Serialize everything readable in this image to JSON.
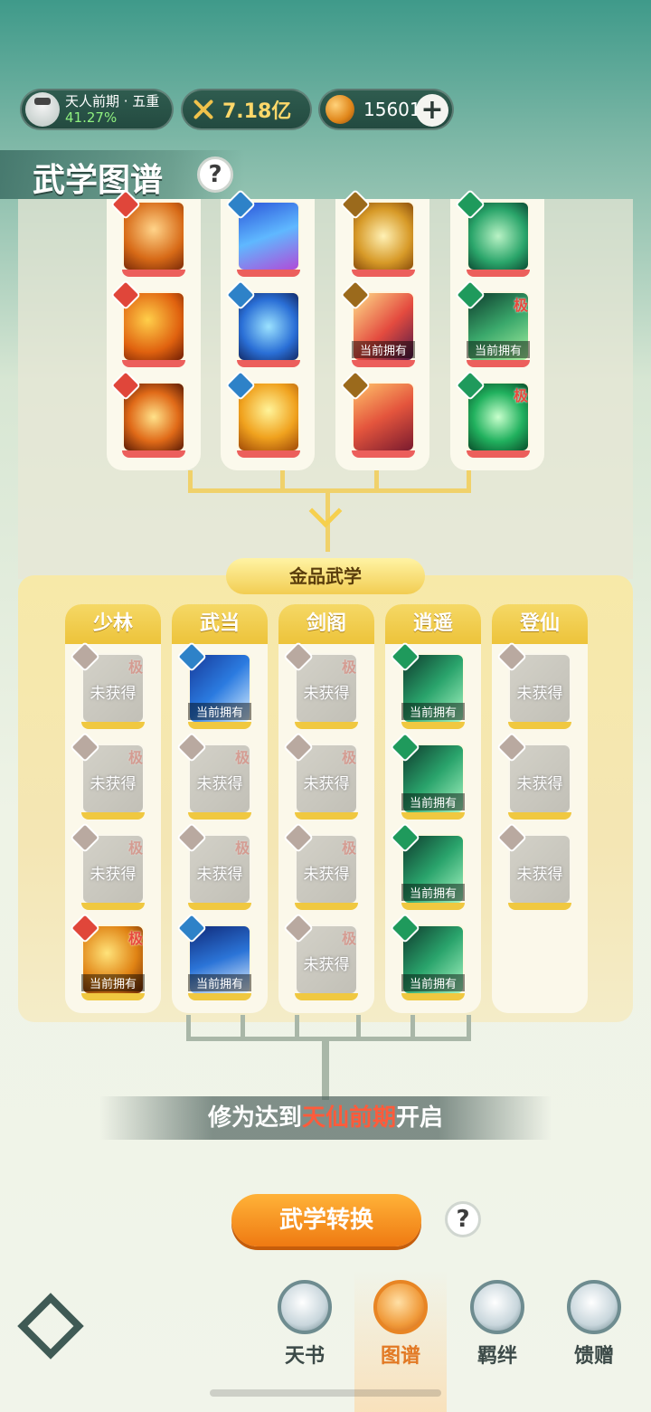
{
  "header": {
    "rank_title": "天人前期 · 五重",
    "rank_progress": "41.27%",
    "power": "7.18亿",
    "coins": "15601",
    "add_label": "+"
  },
  "page": {
    "title": "武学图谱",
    "help": "?"
  },
  "owned_label": "当前拥有",
  "locked_label": "未获得",
  "ultimate_mark": "极",
  "gold_section": {
    "title": "金品武学",
    "schools": [
      "少林",
      "武当",
      "剑阁",
      "逍遥",
      "登仙"
    ]
  },
  "requirement": {
    "prefix": "修为达到",
    "highlight": "天仙前期",
    "suffix": "开启"
  },
  "convert_button": "武学转换",
  "nav": {
    "items": [
      "天书",
      "图谱",
      "羁绊",
      "馈赠"
    ],
    "active": "图谱"
  }
}
